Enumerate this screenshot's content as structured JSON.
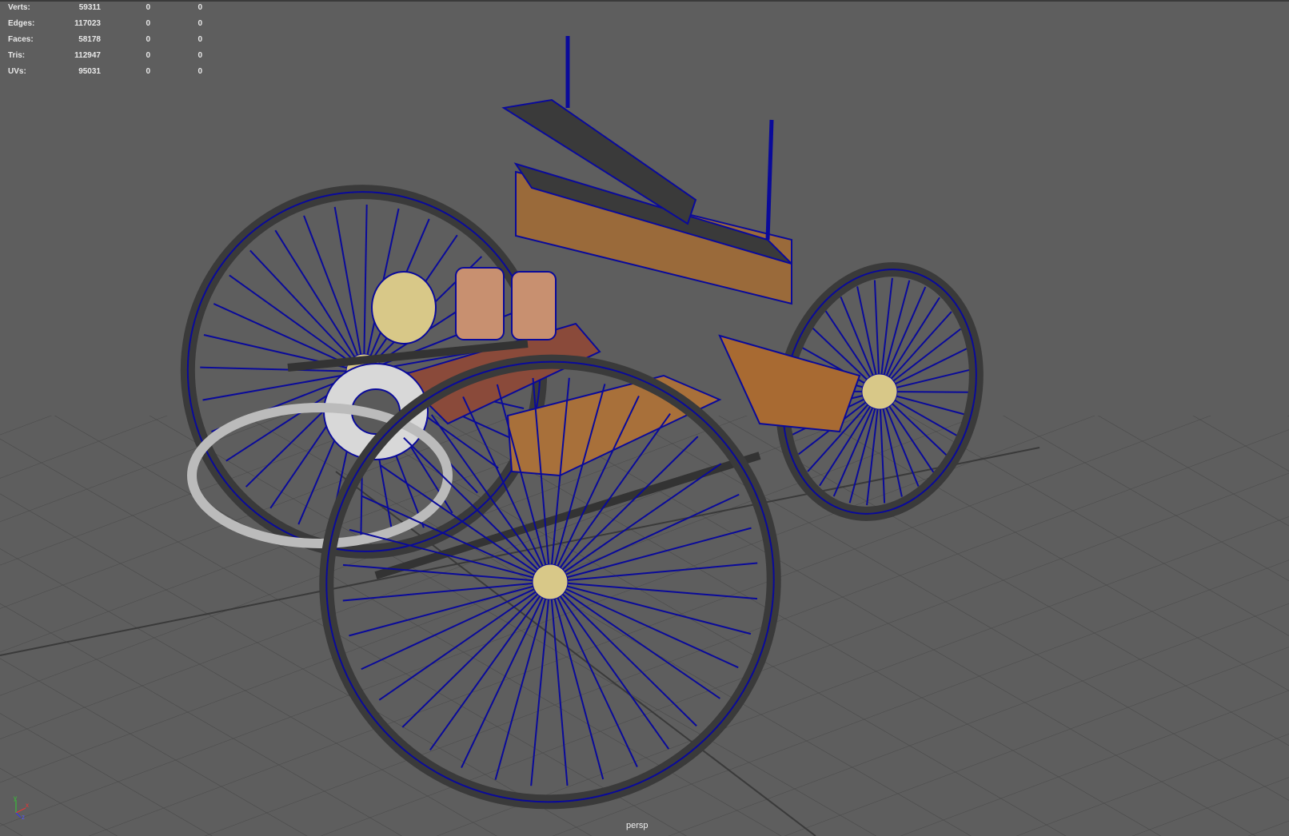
{
  "hud": {
    "rows": [
      {
        "label": "Verts:",
        "total": "59311",
        "selected": "0",
        "count": "0"
      },
      {
        "label": "Edges:",
        "total": "117023",
        "selected": "0",
        "count": "0"
      },
      {
        "label": "Faces:",
        "total": "58178",
        "selected": "0",
        "count": "0"
      },
      {
        "label": "Tris:",
        "total": "112947",
        "selected": "0",
        "count": "0"
      },
      {
        "label": "UVs:",
        "total": "95031",
        "selected": "0",
        "count": "0"
      }
    ]
  },
  "camera_label": "persp",
  "axis": {
    "x": "x",
    "y": "y",
    "z": "z"
  },
  "colors": {
    "background": "#5e5e5e",
    "grid": "#474747",
    "wireframe": "#0a0a9a",
    "wood": "#a86a30",
    "metal": "#3c3c3c"
  }
}
